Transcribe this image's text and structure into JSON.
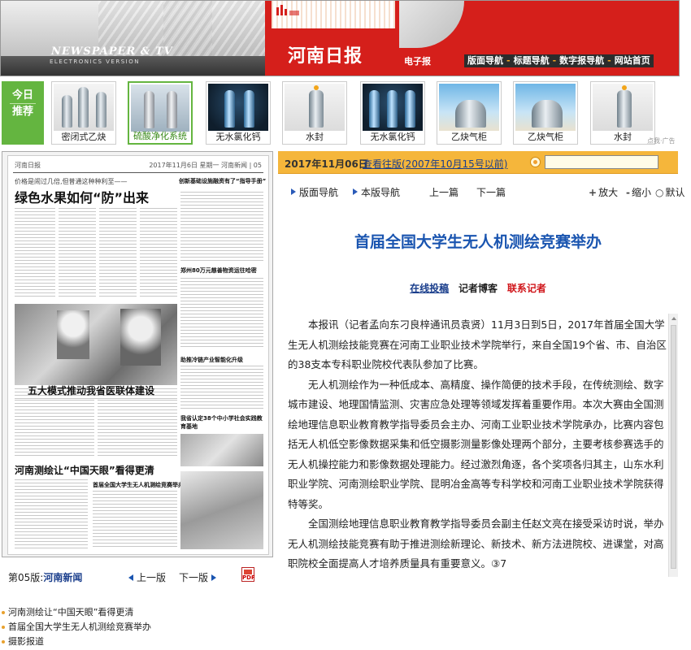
{
  "header": {
    "np_title": "NEWSPAPER & TV",
    "np_sub": "ELECTRONICS VERSION",
    "brand_name": "河南日报",
    "ediv_label": "电子报",
    "nav": [
      "版面导航",
      "标题导航",
      "数字报导航",
      "网站首页"
    ],
    "nav_sep": "-"
  },
  "ads": {
    "today_chars": [
      "今",
      "日",
      "推",
      "荐"
    ],
    "items": [
      {
        "label": "密闭式乙炔",
        "style": "indoor"
      },
      {
        "label": "硫酸净化系统",
        "style": "steel",
        "selected": true
      },
      {
        "label": "无水氯化钙",
        "style": "dark"
      },
      {
        "label": "水封",
        "style": "indoor"
      },
      {
        "label": "无水氯化钙",
        "style": "dark"
      },
      {
        "label": "乙炔气柜",
        "style": "sky"
      },
      {
        "label": "乙炔气柜",
        "style": "sky"
      },
      {
        "label": "水封",
        "style": "indoor"
      }
    ],
    "ad_mark": "点我·广告"
  },
  "thumbnail": {
    "masthead": "河南日报",
    "section": "2017年11月6日 星期一  河南新闻 | 05",
    "headlines": {
      "h1_small": "价格是闹过几倍,但普通这种种利至——",
      "h1": "绿色水果如何“防”出来",
      "h2": "创新基础设施融资有了“指导手册”",
      "h3": "郑州80万元慈善物资运往哈密",
      "h4": "五大模式推动我省医联体建设",
      "h5": "助推冷链产业智能化升级",
      "h6": "河南测绘让“中国天眼”看得更清",
      "h7": "首届全国大学生无人机测绘竞赛举办",
      "h8": "我省认定38个中小学社会实践教育基地"
    }
  },
  "page_footer": {
    "page_label_prefix": "第05版:",
    "page_label_name": "河南新闻",
    "prev": "上一版",
    "next": "下一版"
  },
  "article_list": [
    "河南测绘让“中国天眼”看得更清",
    "首届全国大学生无人机测绘竞赛举办",
    "摄影报道"
  ],
  "date_bar": {
    "date": "2017年11月06日",
    "history": "查看往版(2007年10月15号以前)",
    "search_value": ""
  },
  "toolbar": {
    "layout_nav": "版面导航",
    "section_nav": "本版导航",
    "prev_article": "上一篇",
    "next_article": "下一篇",
    "zoom_in": "放大",
    "zoom_out": "缩小",
    "default": "默认"
  },
  "article": {
    "title": "首届全国大学生无人机测绘竞赛举办",
    "online_submit": "在线投稿",
    "blog": "记者博客",
    "contact": "联系记者",
    "paragraphs": [
      "本报讯（记者孟向东刁良梓通讯员袁贤）11月3日到5日，2017年首届全国大学生无人机测绘技能竞赛在河南工业职业技术学院举行，来自全国19个省、市、自治区的38支本专科职业院校代表队参加了比赛。",
      "无人机测绘作为一种低成本、高精度、操作简便的技术手段，在传统测绘、数字城市建设、地理国情监测、灾害应急处理等领域发挥着重要作用。本次大赛由全国测绘地理信息职业教育教学指导委员会主办、河南工业职业技术学院承办，比赛内容包括无人机低空影像数据采集和低空摄影测量影像处理两个部分，主要考核参赛选手的无人机操控能力和影像数据处理能力。经过激烈角逐，各个奖项各归其主，山东水利职业学院、河南测绘职业学院、昆明冶金高等专科学校和河南工业职业技术学院获得特等奖。",
      "全国测绘地理信息职业教育教学指导委员会副主任赵文亮在接受采访时说，举办无人机测绘技能竞赛有助于推进测绘新理论、新技术、新方法进院校、进课堂，对高职院校全面提高人才培养质量具有重要意义。③7"
    ]
  },
  "colors": {
    "brand_red": "#d51f1b",
    "date_bar": "#f5b63b",
    "title_blue": "#1a55b0",
    "link_blue": "#1a3e8c",
    "recommend_green": "#64b540"
  }
}
